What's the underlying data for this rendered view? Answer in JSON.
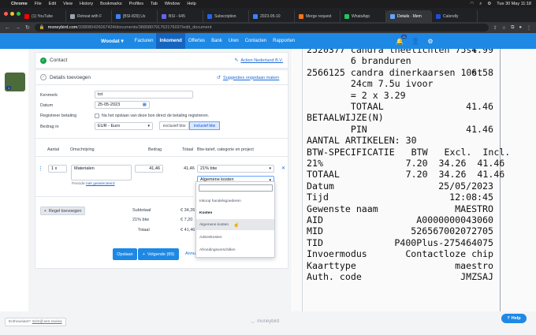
{
  "menubar": {
    "app": "Chrome",
    "items": [
      "File",
      "Edit",
      "View",
      "History",
      "Bookmarks",
      "Profiles",
      "Tab",
      "Window",
      "Help"
    ],
    "clock": "Tue 30 May  11:18"
  },
  "tabs": [
    {
      "label": "(1) YouTube",
      "color": "#ff0000"
    },
    {
      "label": "Retreat with F",
      "color": "#9ca3af"
    },
    {
      "label": "[BSI-829] Us",
      "color": "#3b82f6"
    },
    {
      "label": "BSI - 645",
      "color": "#6366f1"
    },
    {
      "label": "Subscription",
      "color": "#2563eb"
    },
    {
      "label": "2023-05-10",
      "color": "#3b82f6"
    },
    {
      "label": "Merge request",
      "color": "#f97316"
    },
    {
      "label": "WhatsApp",
      "color": "#22c55e"
    },
    {
      "label": "Details · Mem",
      "color": "#60a5fa",
      "active": true
    },
    {
      "label": "Calendly",
      "color": "#1d4ed8"
    }
  ],
  "address": {
    "host": "moneybird.com",
    "path": "/338080426067434/documents/388080791762176037/edit_document"
  },
  "mbnav": {
    "administration": "Woodat",
    "items": [
      "Facturen",
      "Inkomend",
      "Offertes",
      "Bank",
      "Uren",
      "Contacten",
      "Rapporten"
    ],
    "active": "Inkomend",
    "notification_count": "13"
  },
  "avatar_count": "1",
  "contact": {
    "title": "Contact",
    "link": "Action Nederland B.V."
  },
  "details": {
    "title": "Details toevoegen",
    "suggestions_link": "Suggesties ongedaan maken",
    "kenmerk_label": "Kenmerk",
    "kenmerk_value": "tot",
    "datum_label": "Datum",
    "datum_value": "25-05-2023",
    "payment_label": "Registreer betaling",
    "payment_text": "Na het opslaan van deze bon direct de betaling registreren.",
    "amount_label": "Bedrag in",
    "currency": "EUR - Euro",
    "excl": "exclusief btw",
    "incl": "inclusief btw"
  },
  "table": {
    "headers": [
      "Aantal",
      "Omschrijving",
      "Bedrag",
      "Totaal",
      "Btw-tarief, categorie en project"
    ],
    "row": {
      "qty": "1 x",
      "description": "Materialen",
      "period_label": "Periode:",
      "period_link": "niet geselecteerd",
      "amount": "41,46",
      "total": "41,46",
      "vat": "21% btw",
      "category": "Algemene kosten"
    }
  },
  "dropdown": {
    "options": [
      {
        "label": "Inkoop handelsgoederen",
        "group": false
      },
      {
        "label": "Kosten",
        "group": true
      },
      {
        "label": "Algemene kosten",
        "group": false,
        "hover": true
      },
      {
        "label": "Advieskosten",
        "group": false
      },
      {
        "label": "Afrondingsverschillen",
        "group": false
      }
    ]
  },
  "totals": {
    "add_line": "Regel toevoegen",
    "subtotal_label": "Subtotaal",
    "subtotal_value": "€ 34,26",
    "vat_label": "21% btw",
    "vat_value": "€ 7,20",
    "total_label": "Totaal",
    "total_value": "€ 41,46"
  },
  "actions": {
    "save": "Opslaan",
    "next": "Volgende (89)",
    "cancel": "Annu"
  },
  "receipt": {
    "lines": [
      {
        "l": "2520377 candra theelichten 75st",
        "r": "4.99"
      },
      {
        "l": "        6 branduren",
        "r": ""
      },
      {
        "l": "2566125 candra dinerkaarsen 10st",
        "r": "6.58"
      },
      {
        "l": "        24cm 7.5u ivoor",
        "r": ""
      },
      {
        "l": "        = 2 x 3.29",
        "r": ""
      },
      {
        "l": "        TOTAAL",
        "r": "41.46"
      },
      {
        "l": "BETAALWIJZE(N)",
        "r": ""
      },
      {
        "l": "        PIN",
        "r": "41.46"
      },
      {
        "l": "AANTAL ARTIKELEN: 30",
        "r": ""
      },
      {
        "l": "BTW-SPECIFICATIE   BTW   Excl.  Incl.",
        "r": ""
      },
      {
        "l": "21%               7.20  34.26  41.46",
        "r": ""
      },
      {
        "l": "TOTAAL            7.20  34.26  41.46",
        "r": ""
      },
      {
        "l": "Datum",
        "r": "25/05/2023"
      },
      {
        "l": "Tijd",
        "r": "12:08:45"
      },
      {
        "l": "Gewenste naam",
        "r": "MAESTRO"
      },
      {
        "l": "AID",
        "r": "A0000000043060"
      },
      {
        "l": "MID",
        "r": "526567002072705"
      },
      {
        "l": "TID",
        "r": "P400Plus-275464075"
      },
      {
        "l": "Invoermodus",
        "r": "Contactloze chip"
      },
      {
        "l": "Kaarttype",
        "r": "maestro"
      },
      {
        "l": "Auth. code",
        "r": "JMZSAJ"
      }
    ]
  },
  "footer": {
    "enthusiast": "Enthousiast?",
    "review": "Schrijf een review",
    "logo": "moneybird",
    "help": "Help"
  }
}
